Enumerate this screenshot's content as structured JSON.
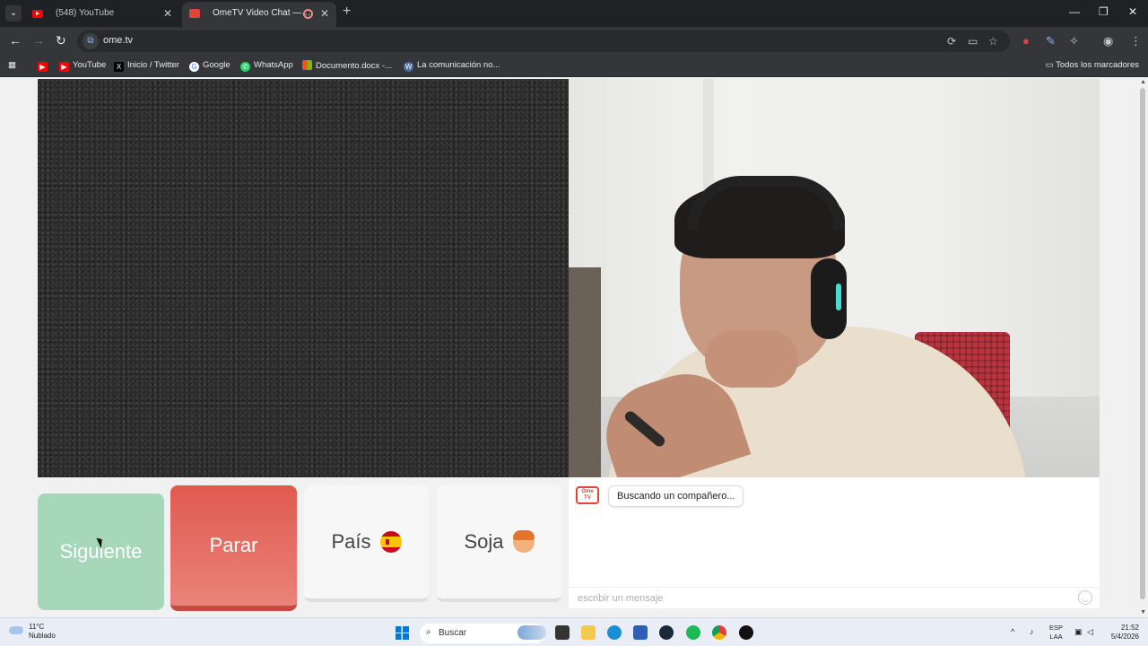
{
  "browser": {
    "tabs": [
      {
        "title": "(548) YouTube",
        "active": false
      },
      {
        "title": "OmeTV Video Chat — Altern",
        "active": true
      }
    ],
    "new_tab": "+",
    "url": "ome.tv",
    "window_controls": {
      "minimize": "—",
      "maximize": "❐",
      "close": "✕"
    }
  },
  "bookmarks": {
    "items": [
      {
        "label": "",
        "icon": "youtube-icon"
      },
      {
        "label": "YouTube",
        "icon": "youtube-icon"
      },
      {
        "label": "Inicio / Twitter",
        "icon": "x-icon"
      },
      {
        "label": "Google",
        "icon": "google-icon"
      },
      {
        "label": "WhatsApp",
        "icon": "whatsapp-icon"
      },
      {
        "label": "Documento.docx -...",
        "icon": "microsoft-icon"
      },
      {
        "label": "La comunicación no...",
        "icon": "wordpress-icon"
      }
    ],
    "all_bookmarks": "Todos los marcadores"
  },
  "controls": {
    "next": "Siguiente",
    "stop": "Parar",
    "country": "País",
    "gender": "Soja"
  },
  "chat": {
    "logo_text": "Ome TV",
    "status_message": "Buscando un compañero...",
    "input_placeholder": "escribir un mensaje"
  },
  "taskbar": {
    "temperature": "11°C",
    "weather": "Nublado",
    "search_label": "Buscar",
    "language_top": "ESP",
    "language_bottom": "LAA",
    "time": "21:52",
    "date": "5/4/2026"
  },
  "colors": {
    "next_button": "#a6d7b9",
    "stop_button": "#e05a4f",
    "accent_red": "#e0443b"
  }
}
